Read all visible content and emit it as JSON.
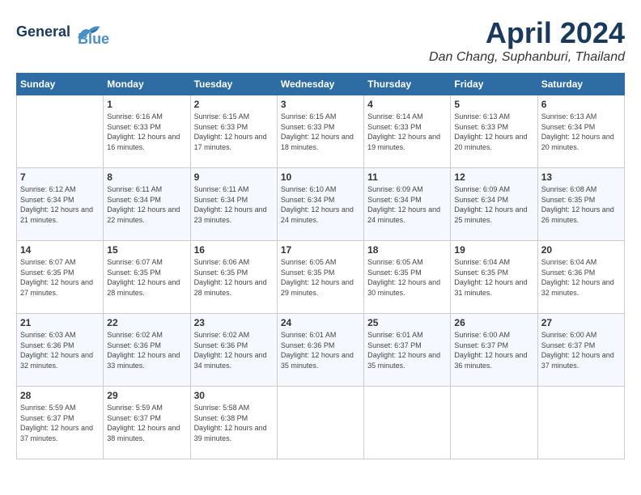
{
  "header": {
    "logo_line1": "General",
    "logo_line2": "Blue",
    "month": "April 2024",
    "location": "Dan Chang, Suphanburi, Thailand"
  },
  "weekdays": [
    "Sunday",
    "Monday",
    "Tuesday",
    "Wednesday",
    "Thursday",
    "Friday",
    "Saturday"
  ],
  "weeks": [
    [
      {
        "day": "",
        "sunrise": "",
        "sunset": "",
        "daylight": ""
      },
      {
        "day": "1",
        "sunrise": "6:16 AM",
        "sunset": "6:33 PM",
        "daylight": "12 hours and 16 minutes."
      },
      {
        "day": "2",
        "sunrise": "6:15 AM",
        "sunset": "6:33 PM",
        "daylight": "12 hours and 17 minutes."
      },
      {
        "day": "3",
        "sunrise": "6:15 AM",
        "sunset": "6:33 PM",
        "daylight": "12 hours and 18 minutes."
      },
      {
        "day": "4",
        "sunrise": "6:14 AM",
        "sunset": "6:33 PM",
        "daylight": "12 hours and 19 minutes."
      },
      {
        "day": "5",
        "sunrise": "6:13 AM",
        "sunset": "6:33 PM",
        "daylight": "12 hours and 20 minutes."
      },
      {
        "day": "6",
        "sunrise": "6:13 AM",
        "sunset": "6:34 PM",
        "daylight": "12 hours and 20 minutes."
      }
    ],
    [
      {
        "day": "7",
        "sunrise": "6:12 AM",
        "sunset": "6:34 PM",
        "daylight": "12 hours and 21 minutes."
      },
      {
        "day": "8",
        "sunrise": "6:11 AM",
        "sunset": "6:34 PM",
        "daylight": "12 hours and 22 minutes."
      },
      {
        "day": "9",
        "sunrise": "6:11 AM",
        "sunset": "6:34 PM",
        "daylight": "12 hours and 23 minutes."
      },
      {
        "day": "10",
        "sunrise": "6:10 AM",
        "sunset": "6:34 PM",
        "daylight": "12 hours and 24 minutes."
      },
      {
        "day": "11",
        "sunrise": "6:09 AM",
        "sunset": "6:34 PM",
        "daylight": "12 hours and 24 minutes."
      },
      {
        "day": "12",
        "sunrise": "6:09 AM",
        "sunset": "6:34 PM",
        "daylight": "12 hours and 25 minutes."
      },
      {
        "day": "13",
        "sunrise": "6:08 AM",
        "sunset": "6:35 PM",
        "daylight": "12 hours and 26 minutes."
      }
    ],
    [
      {
        "day": "14",
        "sunrise": "6:07 AM",
        "sunset": "6:35 PM",
        "daylight": "12 hours and 27 minutes."
      },
      {
        "day": "15",
        "sunrise": "6:07 AM",
        "sunset": "6:35 PM",
        "daylight": "12 hours and 28 minutes."
      },
      {
        "day": "16",
        "sunrise": "6:06 AM",
        "sunset": "6:35 PM",
        "daylight": "12 hours and 28 minutes."
      },
      {
        "day": "17",
        "sunrise": "6:05 AM",
        "sunset": "6:35 PM",
        "daylight": "12 hours and 29 minutes."
      },
      {
        "day": "18",
        "sunrise": "6:05 AM",
        "sunset": "6:35 PM",
        "daylight": "12 hours and 30 minutes."
      },
      {
        "day": "19",
        "sunrise": "6:04 AM",
        "sunset": "6:35 PM",
        "daylight": "12 hours and 31 minutes."
      },
      {
        "day": "20",
        "sunrise": "6:04 AM",
        "sunset": "6:36 PM",
        "daylight": "12 hours and 32 minutes."
      }
    ],
    [
      {
        "day": "21",
        "sunrise": "6:03 AM",
        "sunset": "6:36 PM",
        "daylight": "12 hours and 32 minutes."
      },
      {
        "day": "22",
        "sunrise": "6:02 AM",
        "sunset": "6:36 PM",
        "daylight": "12 hours and 33 minutes."
      },
      {
        "day": "23",
        "sunrise": "6:02 AM",
        "sunset": "6:36 PM",
        "daylight": "12 hours and 34 minutes."
      },
      {
        "day": "24",
        "sunrise": "6:01 AM",
        "sunset": "6:36 PM",
        "daylight": "12 hours and 35 minutes."
      },
      {
        "day": "25",
        "sunrise": "6:01 AM",
        "sunset": "6:37 PM",
        "daylight": "12 hours and 35 minutes."
      },
      {
        "day": "26",
        "sunrise": "6:00 AM",
        "sunset": "6:37 PM",
        "daylight": "12 hours and 36 minutes."
      },
      {
        "day": "27",
        "sunrise": "6:00 AM",
        "sunset": "6:37 PM",
        "daylight": "12 hours and 37 minutes."
      }
    ],
    [
      {
        "day": "28",
        "sunrise": "5:59 AM",
        "sunset": "6:37 PM",
        "daylight": "12 hours and 37 minutes."
      },
      {
        "day": "29",
        "sunrise": "5:59 AM",
        "sunset": "6:37 PM",
        "daylight": "12 hours and 38 minutes."
      },
      {
        "day": "30",
        "sunrise": "5:58 AM",
        "sunset": "6:38 PM",
        "daylight": "12 hours and 39 minutes."
      },
      {
        "day": "",
        "sunrise": "",
        "sunset": "",
        "daylight": ""
      },
      {
        "day": "",
        "sunrise": "",
        "sunset": "",
        "daylight": ""
      },
      {
        "day": "",
        "sunrise": "",
        "sunset": "",
        "daylight": ""
      },
      {
        "day": "",
        "sunrise": "",
        "sunset": "",
        "daylight": ""
      }
    ]
  ]
}
